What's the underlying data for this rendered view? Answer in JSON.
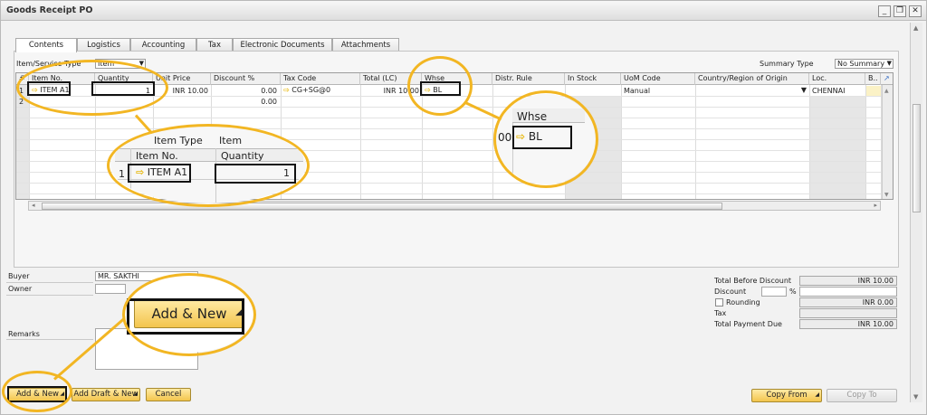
{
  "window": {
    "title": "Goods Receipt PO"
  },
  "window_buttons": {
    "minimize": "_",
    "restore": "❐",
    "close": "✕"
  },
  "tabs": [
    "Contents",
    "Logistics",
    "Accounting",
    "Tax",
    "Electronic Documents",
    "Attachments"
  ],
  "header": {
    "item_service_type_label": "Item/Service Type",
    "item_service_type_value": "Item",
    "summary_type_label": "Summary Type",
    "summary_type_value": "No Summary"
  },
  "grid": {
    "columns": [
      "#",
      "Item No.",
      "Quantity",
      "Unit Price",
      "Discount %",
      "Tax Code",
      "Total (LC)",
      "Whse",
      "Distr. Rule",
      "In Stock",
      "UoM Code",
      "Country/Region of Origin",
      "Loc.",
      "B.."
    ],
    "row1": {
      "num": "1",
      "item_no": "ITEM A1",
      "quantity": "1",
      "unit_price": "INR 10.00",
      "discount": "0.00",
      "tax_code": "CG+SG@0",
      "total": "INR 10.00",
      "whse": "BL",
      "uom": "Manual",
      "loc": "CHENNAI"
    },
    "row2": {
      "num": "2",
      "discount": "0.00"
    }
  },
  "zoom_left": {
    "type_label": "Item Type",
    "type_value": "Item",
    "col_item": "Item No.",
    "col_qty": "Quantity",
    "row1_num": "1",
    "row2_num": "2",
    "item": "ITEM A1",
    "qty": "1"
  },
  "zoom_right": {
    "header": "Whse",
    "prefix": "00",
    "value": "BL"
  },
  "buyer": {
    "label": "Buyer",
    "value": "MR. SAKTHI"
  },
  "owner": {
    "label": "Owner"
  },
  "remarks": {
    "label": "Remarks"
  },
  "totals": {
    "before_discount_label": "Total Before Discount",
    "before_discount_value": "INR 10.00",
    "discount_label": "Discount",
    "pct": "%",
    "rounding_label": "Rounding",
    "rounding_value": "INR 0.00",
    "tax_label": "Tax",
    "due_label": "Total Payment Due",
    "due_value": "INR 10.00"
  },
  "buttons": {
    "add_new": "Add & New",
    "add_draft_new": "Add Draft & New",
    "cancel": "Cancel",
    "copy_from": "Copy From",
    "copy_to": "Copy To",
    "add_new_zoom": "Add & New"
  }
}
